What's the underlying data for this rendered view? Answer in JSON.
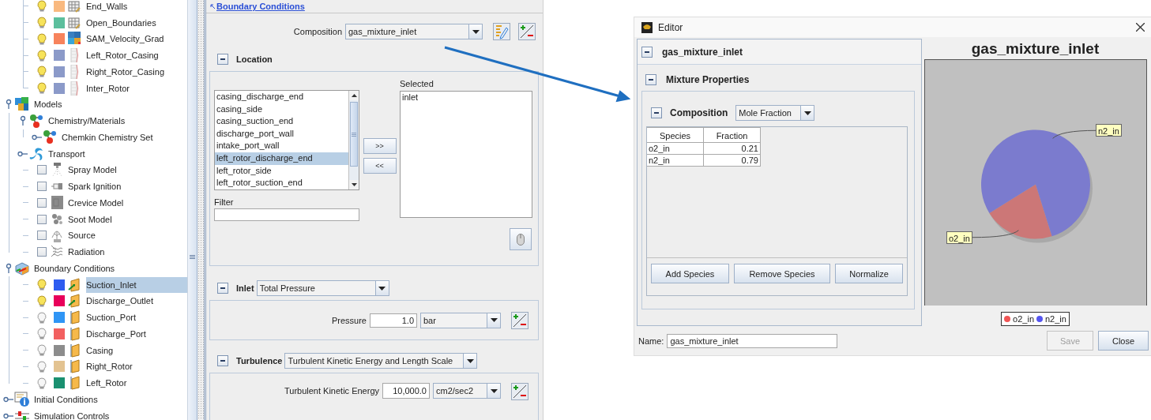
{
  "tree": [
    {
      "children": [
        {
          "label": "End_Walls",
          "kind": "grid",
          "on": true,
          "color": "#f9b97f",
          "selected": false
        },
        {
          "label": "Open_Boundaries",
          "kind": "grid",
          "on": true,
          "color": "#5cbf9d",
          "selected": false
        },
        {
          "label": "SAM_Velocity_Grad",
          "kind": "patch",
          "on": true,
          "color": "#f7835c",
          "selected": false
        },
        {
          "label": "Left_Rotor_Casing",
          "kind": "strip",
          "on": true,
          "color": "#8b9ac9",
          "selected": false
        },
        {
          "label": "Right_Rotor_Casing",
          "kind": "strip",
          "on": true,
          "color": "#8b9ac9",
          "selected": false
        },
        {
          "label": "Inter_Rotor",
          "kind": "strip",
          "on": true,
          "color": "#8b9ac9",
          "selected": false
        }
      ]
    },
    {
      "label": "Models",
      "kind": "models",
      "expanded": true,
      "selected": false,
      "children": [
        {
          "label": "Chemistry/Materials",
          "kind": "chemistry",
          "expanded": true,
          "selected": false,
          "children": [
            {
              "label": "Chemkin Chemistry Set",
              "kind": "chemistry",
              "expanded": false,
              "selected": false
            }
          ]
        },
        {
          "label": "Transport",
          "kind": "transport",
          "expanded": false,
          "selected": false
        },
        {
          "label": "Spray Model",
          "kind": "spray",
          "checked": false,
          "selected": false
        },
        {
          "label": "Spark Ignition",
          "kind": "spark",
          "checked": false,
          "selected": false
        },
        {
          "label": "Crevice Model",
          "kind": "crevice",
          "checked": false,
          "selected": false
        },
        {
          "label": "Soot Model",
          "kind": "soot",
          "checked": false,
          "selected": false
        },
        {
          "label": "Source",
          "kind": "source",
          "checked": false,
          "selected": false
        },
        {
          "label": "Radiation",
          "kind": "radiation",
          "checked": false,
          "selected": false
        }
      ]
    },
    {
      "label": "Boundary Conditions",
      "kind": "boundary",
      "expanded": true,
      "selected": false,
      "children": [
        {
          "label": "Suction_Inlet",
          "kind": "bc-arrow",
          "on": true,
          "color": "#2e5cf0",
          "selected": true
        },
        {
          "label": "Discharge_Outlet",
          "kind": "bc-arrow",
          "on": true,
          "color": "#e8005a",
          "selected": false
        },
        {
          "label": "Suction_Port",
          "kind": "bc",
          "on": false,
          "color": "#2f95f5",
          "selected": false
        },
        {
          "label": "Discharge_Port",
          "kind": "bc",
          "on": false,
          "color": "#f26060",
          "selected": false
        },
        {
          "label": "Casing",
          "kind": "bc",
          "on": false,
          "color": "#8c8c8c",
          "selected": false
        },
        {
          "label": "Right_Rotor",
          "kind": "bc",
          "on": false,
          "color": "#e3c391",
          "selected": false
        },
        {
          "label": "Left_Rotor",
          "kind": "bc",
          "on": false,
          "color": "#1a9070",
          "selected": false
        }
      ]
    },
    {
      "label": "Initial Conditions",
      "kind": "initial",
      "expanded": false,
      "selected": false
    },
    {
      "label": "Simulation Controls",
      "kind": "controls",
      "expanded": false,
      "selected": false
    }
  ],
  "form": {
    "breadcrumb": "Boundary Conditions",
    "composition": {
      "label": "Composition",
      "value": "gas_mixture_inlet"
    },
    "location": {
      "title": "Location",
      "expanded": true,
      "selected_label": "Selected",
      "add_button": ">>",
      "remove_button": "<<",
      "filter_label": "Filter",
      "available": [
        {
          "label": "casing_discharge_end",
          "selected": false
        },
        {
          "label": "casing_side",
          "selected": false
        },
        {
          "label": "casing_suction_end",
          "selected": false
        },
        {
          "label": "discharge_port_wall",
          "selected": false
        },
        {
          "label": "intake_port_wall",
          "selected": false
        },
        {
          "label": "left_rotor_discharge_end",
          "selected": true
        },
        {
          "label": "left_rotor_side",
          "selected": false
        },
        {
          "label": "left_rotor_suction_end",
          "selected": false
        }
      ],
      "selected_items": [
        "inlet"
      ]
    },
    "inlet": {
      "title": "Inlet",
      "expanded": true,
      "type": "Total Pressure",
      "label": "Pressure",
      "value": "1.0",
      "unit": "bar"
    },
    "turbulence": {
      "title": "Turbulence",
      "expanded": true,
      "type": "Turbulent Kinetic Energy and Length Scale",
      "label": "Turbulent Kinetic Energy",
      "value": "10,000.0",
      "unit": "cm2/sec2"
    }
  },
  "editor": {
    "title": "Editor",
    "header": {
      "title": "gas_mixture_inlet",
      "expanded": true
    },
    "mixture": {
      "title": "Mixture Properties",
      "expanded": true
    },
    "composition": {
      "label": "Composition",
      "value": "Mole Fraction",
      "expanded": true
    },
    "table": {
      "columns": [
        "Species",
        "Fraction"
      ],
      "rows": [
        [
          "o2_in",
          "0.21"
        ],
        [
          "n2_in",
          "0.79"
        ]
      ]
    },
    "buttons": [
      "Add Species",
      "Remove Species",
      "Normalize"
    ],
    "name_label": "Name:",
    "name_value": "gas_mixture_inlet",
    "actions": [
      {
        "label": "Save",
        "disabled": true
      },
      {
        "label": "Close",
        "disabled": false
      }
    ],
    "chart_data": {
      "type": "pie",
      "title": "gas_mixture_inlet",
      "categories": [
        "o2_in",
        "n2_in"
      ],
      "values": [
        0.21,
        0.79
      ]
    },
    "legend": [
      "o2_in",
      "n2_in"
    ]
  }
}
